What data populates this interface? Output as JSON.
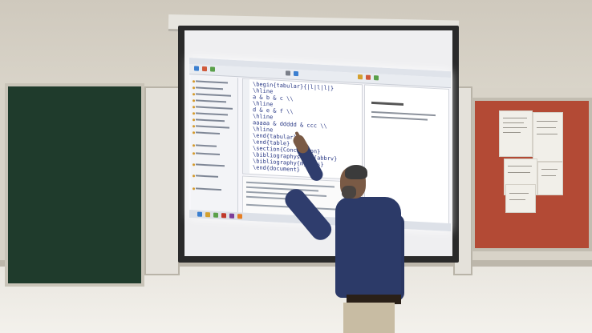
{
  "scene": {
    "type": "photo",
    "colors": {
      "wall": "#d8d3c8",
      "greenboard": "#1f3b2c",
      "corkboard": "#b34a35",
      "screen_border": "#2a2a2a",
      "projection": "#f6f6fa",
      "shirt": "#2c3a68",
      "pants": "#c8bca3"
    }
  },
  "projection": {
    "code_lines": [
      "\\begin{tabular}{|l|l|l|}",
      "\\hline",
      "a & b & c \\\\",
      "\\hline",
      "d & e & f \\\\",
      "\\hline",
      "aaaaa & ddddd & ccc \\\\",
      "\\hline",
      "\\end{tabular}",
      "\\end{table}",
      "\\section{Conclusion}",
      "\\bibliographystyle{abbrv}",
      "\\bibliography{myrefs}",
      "\\end{document}"
    ]
  }
}
